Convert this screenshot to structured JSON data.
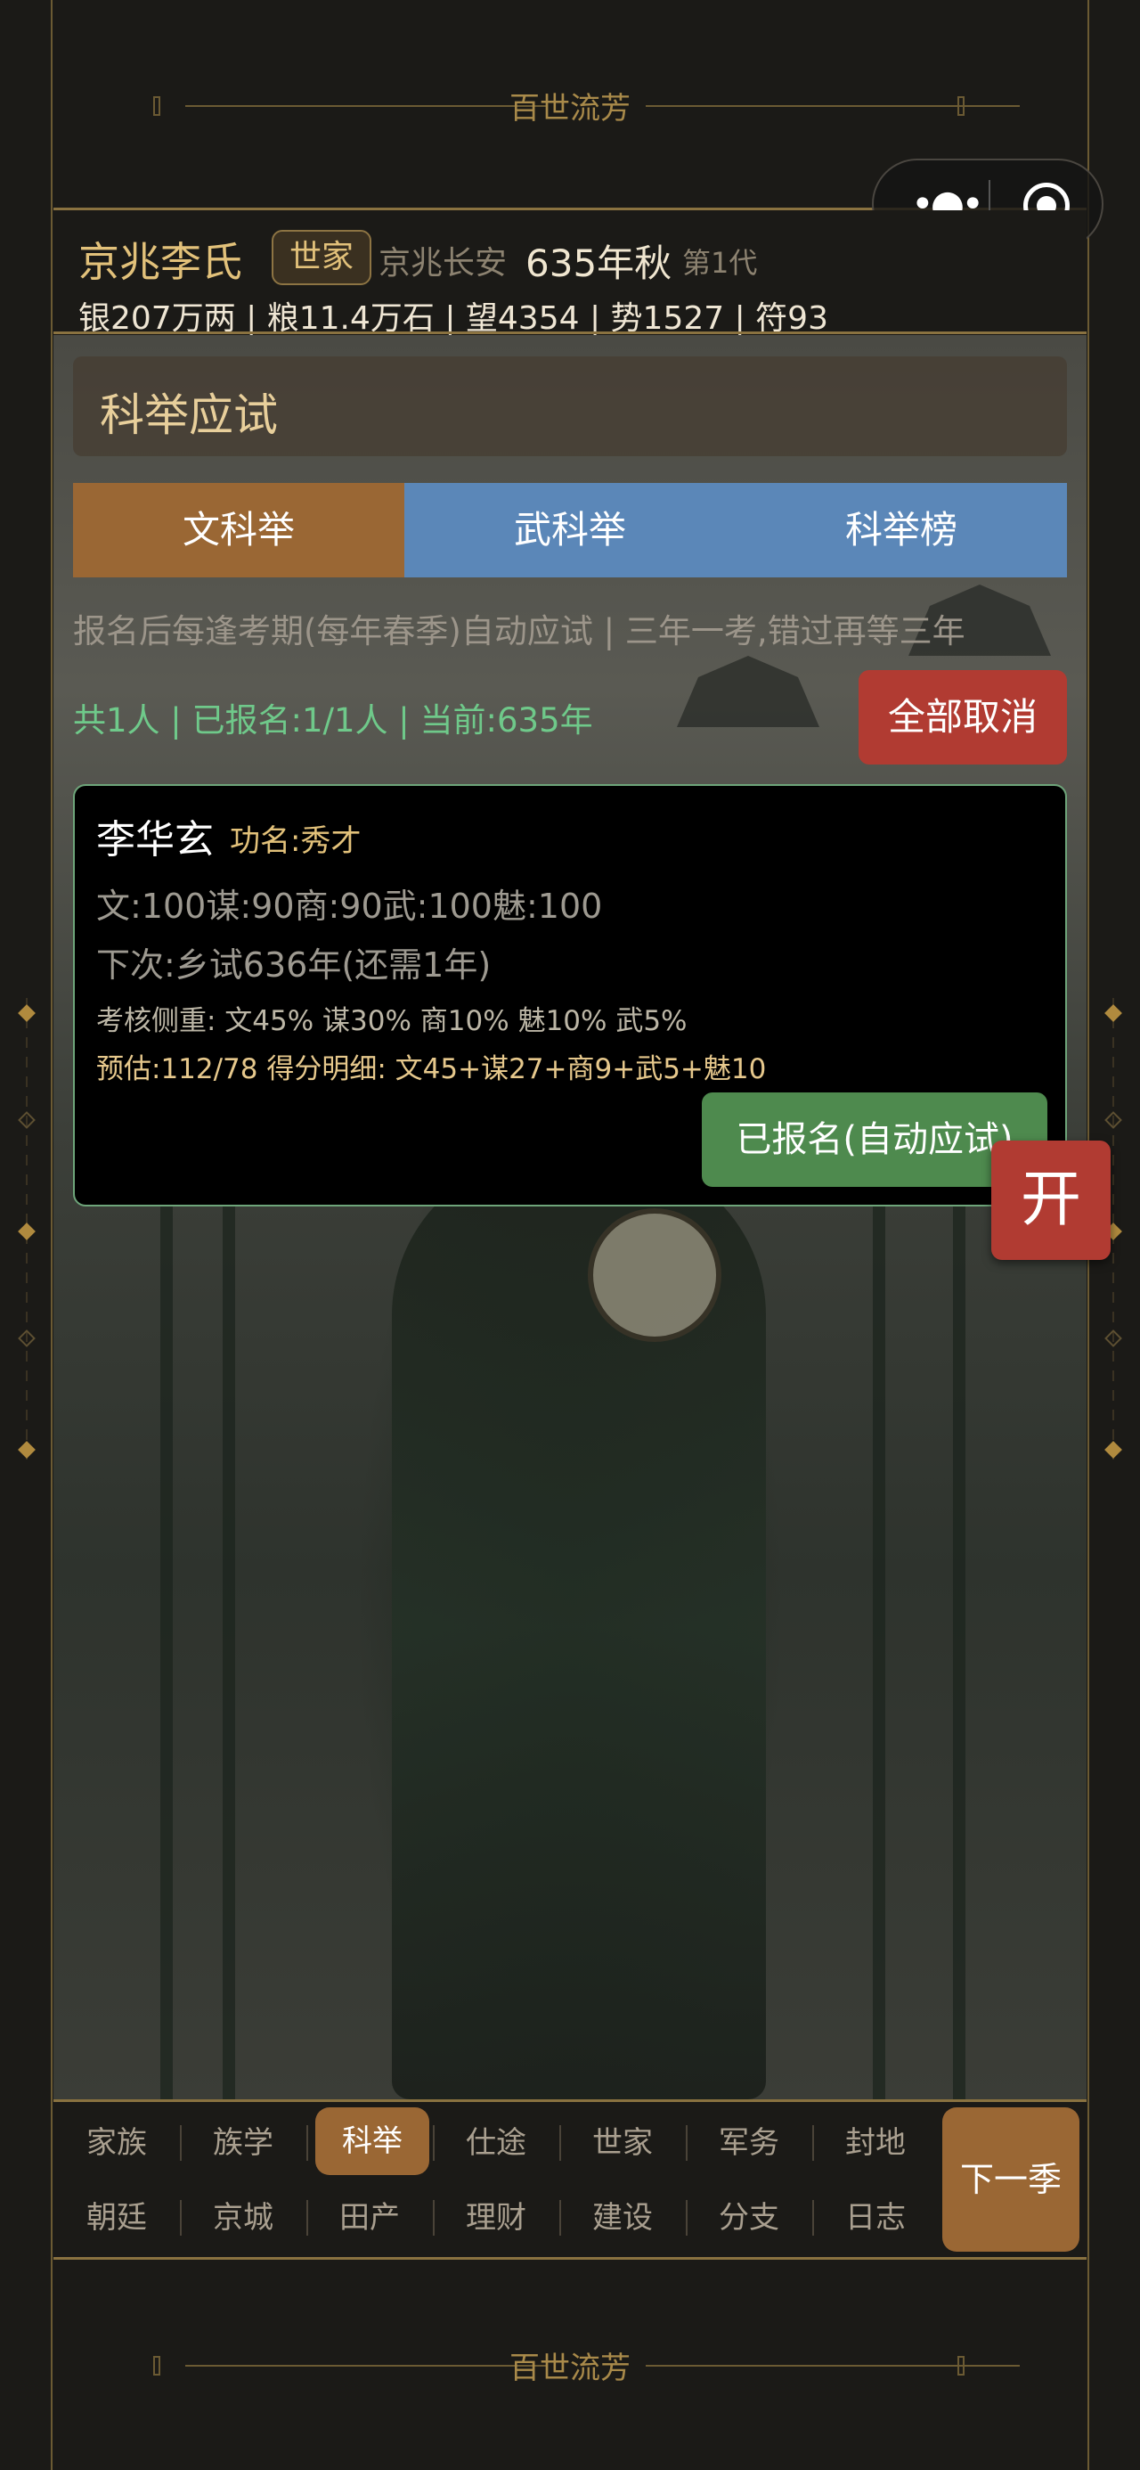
{
  "banner": {
    "title": "百世流芳"
  },
  "header": {
    "clan_name": "京兆李氏",
    "clan_badge": "世家",
    "location": "京兆长安",
    "date": "635年秋",
    "generation": "第1代",
    "stats": "银207万两 | 粮11.4万石 | 望4354 | 势1527 | 符93"
  },
  "exam": {
    "title": "科举应试",
    "tabs": [
      {
        "label": "文科举",
        "active": true
      },
      {
        "label": "武科举",
        "active": false
      },
      {
        "label": "科举榜",
        "active": false
      }
    ],
    "notice": "报名后每逢考期(每年春季)自动应试 | 三年一考,错过再等三年",
    "counter": "共1人 | 已报名:1/1人 | 当前:635年",
    "cancel_all_label": "全部取消",
    "candidate": {
      "name": "李华玄",
      "rank": "功名:秀才",
      "attributes": "文:100谋:90商:90武:100魅:100",
      "next_exam": "下次:乡试636年(还需1年)",
      "weights": "考核侧重: 文45% 谋30% 商10% 魅10% 武5%",
      "estimate": "预估:112/78  得分明细: 文45+谋27+商9+武5+魅10",
      "status_button": "已报名(自动应试)"
    }
  },
  "float_button": {
    "label": "开"
  },
  "nav": {
    "row1": [
      {
        "label": "家族",
        "active": false
      },
      {
        "label": "族学",
        "active": false
      },
      {
        "label": "科举",
        "active": true
      },
      {
        "label": "仕途",
        "active": false
      },
      {
        "label": "世家",
        "active": false
      },
      {
        "label": "军务",
        "active": false
      },
      {
        "label": "封地",
        "active": false
      }
    ],
    "row2": [
      {
        "label": "朝廷",
        "active": false
      },
      {
        "label": "京城",
        "active": false
      },
      {
        "label": "田产",
        "active": false
      },
      {
        "label": "理财",
        "active": false
      },
      {
        "label": "建设",
        "active": false
      },
      {
        "label": "分支",
        "active": false
      },
      {
        "label": "日志",
        "active": false
      }
    ],
    "next_season_label": "下一季"
  },
  "icons": {
    "menu": "more-dots-icon",
    "close": "target-circle-icon"
  }
}
